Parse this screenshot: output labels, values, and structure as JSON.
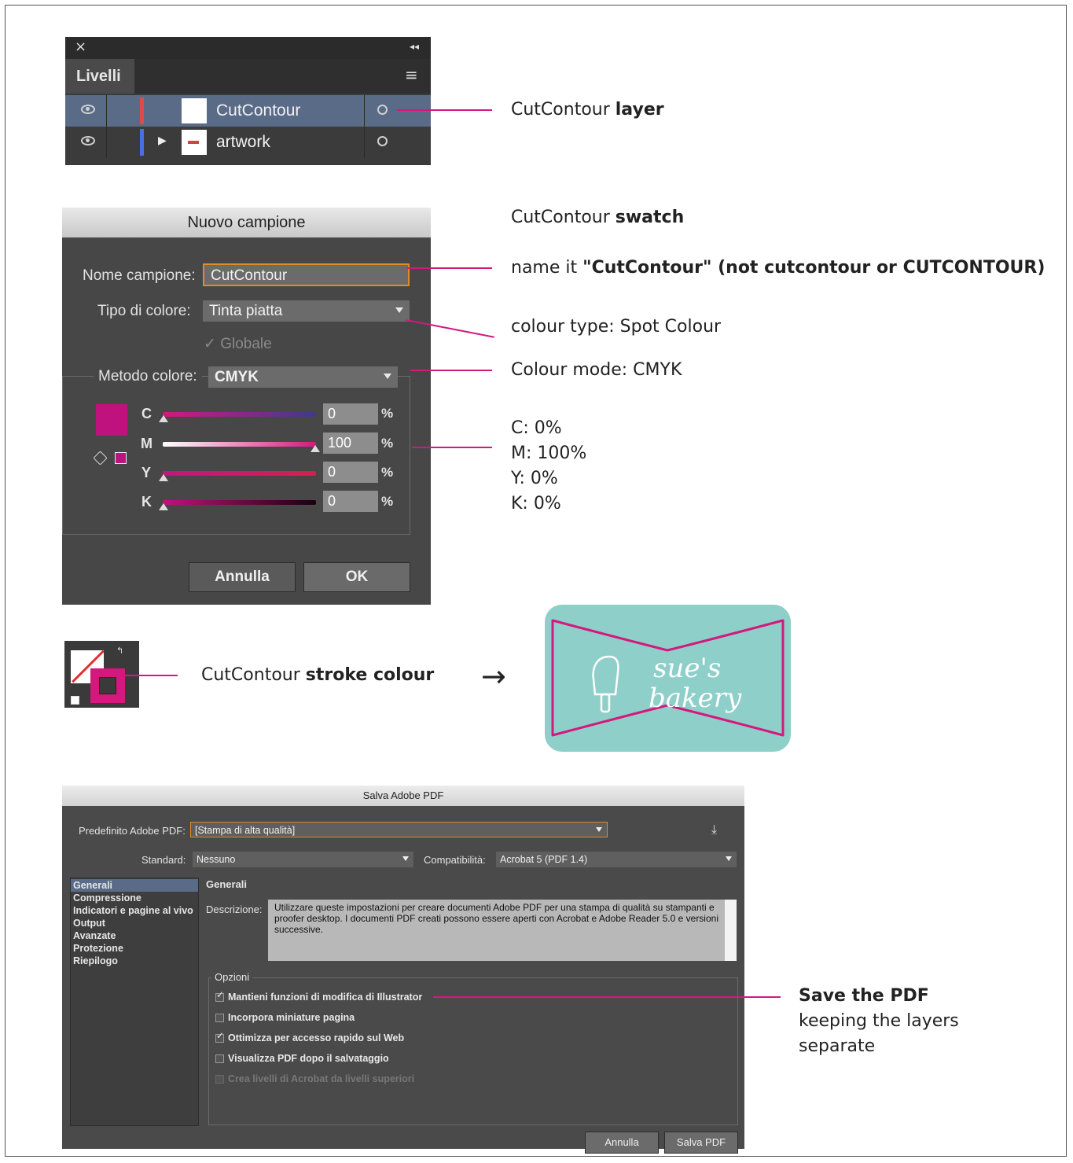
{
  "layers_panel": {
    "close_glyph": "×",
    "collapse_glyph": "◂◂",
    "tab_label": "Livelli",
    "menu_glyph": "≡",
    "rows": [
      {
        "name": "CutContour",
        "color": "#e04a4a",
        "expand": ""
      },
      {
        "name": "artwork",
        "color": "#4a6fe0",
        "expand": "▶"
      }
    ]
  },
  "annotations": {
    "layer_pre": "CutContour ",
    "layer_bold": "layer",
    "swatch_pre": "CutContour ",
    "swatch_bold": "swatch",
    "name_pre": "name it ",
    "name_bold": "\"CutContour\" (not cutcontour or CUTCONTOUR)",
    "colour_type": "colour type: Spot Colour",
    "colour_mode": "Colour mode: CMYK",
    "cmyk_values": [
      "C: 0%",
      "M: 100%",
      "Y: 0%",
      "K: 0%"
    ],
    "stroke_pre": "CutContour ",
    "stroke_bold": "stroke colour",
    "arrow_glyph": "→",
    "save_bold": "Save the PDF",
    "save_rest_1": "keeping the layers",
    "save_rest_2": "separate"
  },
  "swatch_dialog": {
    "title": "Nuovo campione",
    "name_label": "Nome campione:",
    "name_value": "CutContour",
    "type_label": "Tipo di colore:",
    "type_value": "Tinta piatta",
    "global_label": "Globale",
    "mode_label": "Metodo colore:",
    "mode_value": "CMYK",
    "sliders": [
      {
        "letter": "C",
        "value": "0",
        "unit": "%"
      },
      {
        "letter": "M",
        "value": "100",
        "unit": "%"
      },
      {
        "letter": "Y",
        "value": "0",
        "unit": "%"
      },
      {
        "letter": "K",
        "value": "0",
        "unit": "%"
      }
    ],
    "cancel_label": "Annulla",
    "ok_label": "OK",
    "swatch_color": "#c0127e"
  },
  "logo": {
    "line1": "sue's",
    "line2": "bakery",
    "bg_color": "#8fcfc9",
    "border_color": "#d4187e"
  },
  "pdf_dialog": {
    "title": "Salva Adobe PDF",
    "preset_label": "Predefinito Adobe PDF:",
    "preset_value": "[Stampa di alta qualità]",
    "standard_label": "Standard:",
    "standard_value": "Nessuno",
    "compat_label": "Compatibilità:",
    "compat_value": "Acrobat 5 (PDF 1.4)",
    "nav": [
      "Generali",
      "Compressione",
      "Indicatori e pagine al vivo",
      "Output",
      "Avanzate",
      "Protezione",
      "Riepilogo"
    ],
    "section_title": "Generali",
    "desc_label": "Descrizione:",
    "desc_text": "Utilizzare queste impostazioni per creare documenti Adobe PDF per una stampa di qualità su stampanti e proofer desktop. I documenti PDF creati possono essere aperti con Acrobat e Adobe Reader 5.0 e versioni successive.",
    "options_title": "Opzioni",
    "options": [
      {
        "label": "Mantieni funzioni di modifica di Illustrator",
        "checked": true,
        "enabled": true
      },
      {
        "label": "Incorpora miniature pagina",
        "checked": false,
        "enabled": true
      },
      {
        "label": "Ottimizza per accesso rapido sul Web",
        "checked": true,
        "enabled": true
      },
      {
        "label": "Visualizza PDF dopo il salvataggio",
        "checked": false,
        "enabled": true
      },
      {
        "label": "Crea livelli di Acrobat da livelli superiori",
        "checked": false,
        "enabled": false
      }
    ],
    "cancel_label": "Annulla",
    "save_label": "Salva PDF"
  },
  "accent_color": "#d4187e"
}
